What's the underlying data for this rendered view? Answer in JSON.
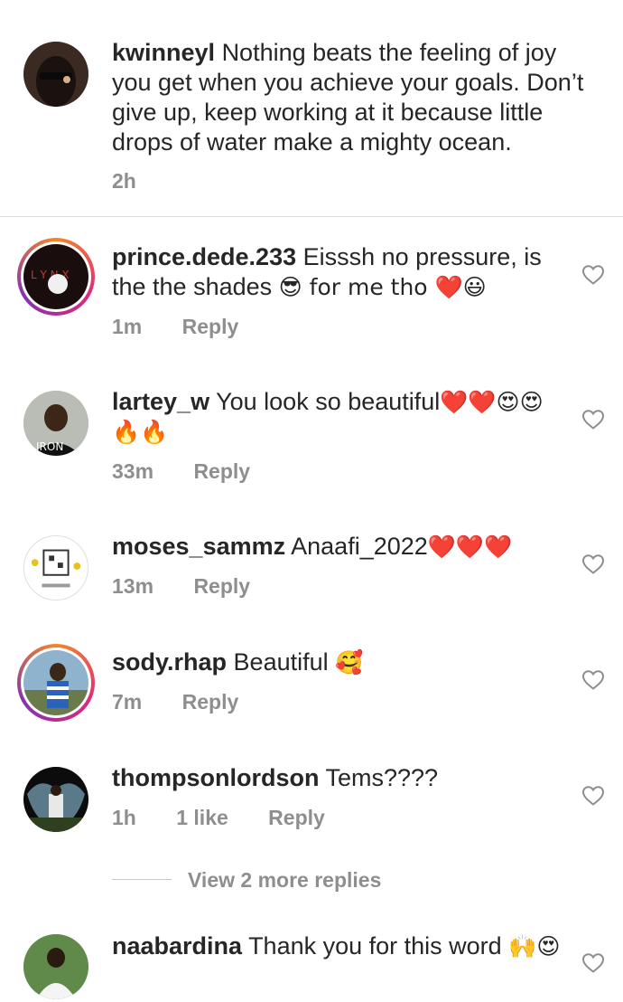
{
  "caption": {
    "username": "kwinneyl",
    "text": "Nothing beats the feeling of joy you get when you achieve your goals. Don’t give up, keep working at it because little drops of water make a mighty ocean.",
    "time": "2h"
  },
  "comments": [
    {
      "username": "prince.dede.233",
      "text": "Eisssh no pressure, is the the shades ",
      "emoji": "😎 for me tho ❤️😃",
      "time": "1m",
      "likes": "",
      "reply": "Reply"
    },
    {
      "username": "lartey_w",
      "text": "You look so beautiful",
      "emoji": "❤️❤️😍😍🔥🔥",
      "time": "33m",
      "likes": "",
      "reply": "Reply"
    },
    {
      "username": "moses_sammz",
      "text": "Anaafi_2022",
      "emoji": "❤️❤️❤️",
      "time": "13m",
      "likes": "",
      "reply": "Reply"
    },
    {
      "username": "sody.rhap",
      "text": "Beautiful ",
      "emoji": "🥰",
      "time": "7m",
      "likes": "",
      "reply": "Reply"
    },
    {
      "username": "thompsonlordson",
      "text": "Tems????",
      "emoji": "",
      "time": "1h",
      "likes": "1 like",
      "reply": "Reply"
    },
    {
      "username": "naabardina",
      "text": "Thank you for this word ",
      "emoji": "🙌😍",
      "time": "",
      "likes": "",
      "reply": ""
    }
  ],
  "view_more_replies": "View 2 more replies",
  "icons": {
    "like": "heart-outline-icon"
  },
  "colors": {
    "meta_gray": "#8e8e8e",
    "text": "#262626",
    "divider": "#dbdbdb"
  }
}
